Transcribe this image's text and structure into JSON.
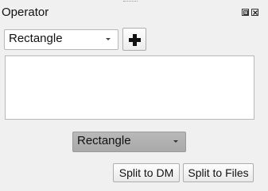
{
  "panel": {
    "title": "Operator",
    "float_icon": "restore-icon",
    "close_icon": "close-icon"
  },
  "operator_select": {
    "value": "Rectangle",
    "icon": "chevron-down-icon"
  },
  "add_button": {
    "icon": "plus-icon"
  },
  "operator_list": {
    "items": []
  },
  "shape_select": {
    "value": "Rectangle",
    "icon": "chevron-down-icon"
  },
  "actions": {
    "split_dm_label": "Split to DM",
    "split_files_label": "Split to Files"
  }
}
